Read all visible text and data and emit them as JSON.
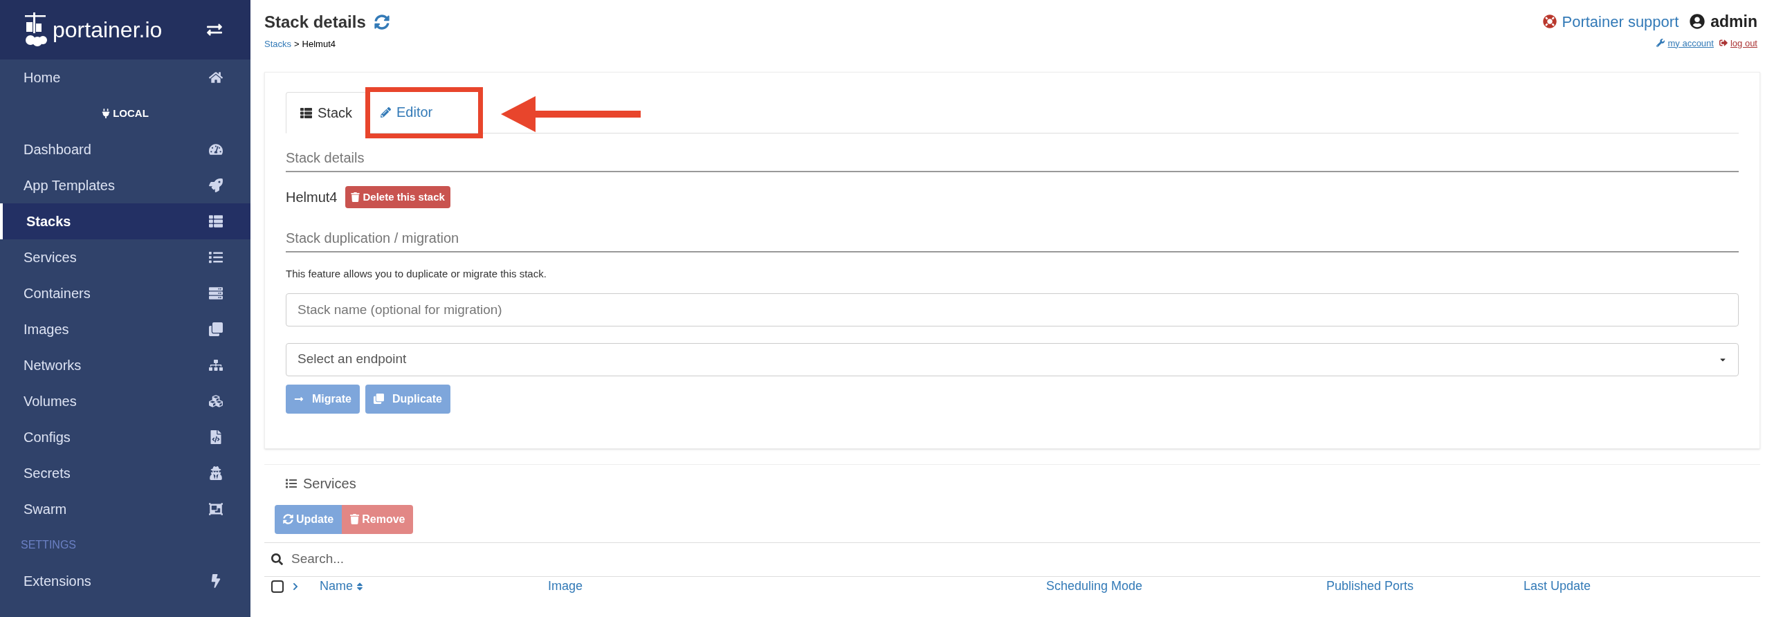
{
  "sidebar": {
    "logo": "portainer.io",
    "items": [
      {
        "kind": "item",
        "label": "Home",
        "selected": false
      },
      {
        "kind": "endpoint",
        "label": "LOCAL"
      },
      {
        "kind": "item",
        "label": "Dashboard",
        "selected": false
      },
      {
        "kind": "item",
        "label": "App Templates",
        "selected": false
      },
      {
        "kind": "item",
        "label": "Stacks",
        "selected": true
      },
      {
        "kind": "item",
        "label": "Services",
        "selected": false
      },
      {
        "kind": "item",
        "label": "Containers",
        "selected": false
      },
      {
        "kind": "item",
        "label": "Images",
        "selected": false
      },
      {
        "kind": "item",
        "label": "Networks",
        "selected": false
      },
      {
        "kind": "item",
        "label": "Volumes",
        "selected": false
      },
      {
        "kind": "item",
        "label": "Configs",
        "selected": false
      },
      {
        "kind": "item",
        "label": "Secrets",
        "selected": false
      },
      {
        "kind": "item",
        "label": "Swarm",
        "selected": false
      },
      {
        "kind": "section",
        "label": "SETTINGS"
      },
      {
        "kind": "item",
        "label": "Extensions",
        "selected": false
      }
    ]
  },
  "header": {
    "title": "Stack details",
    "breadcrumb": {
      "link": "Stacks",
      "separator": ">",
      "current": "Helmut4"
    },
    "support": "Portainer support",
    "user": "admin",
    "account_link": "my account",
    "logout_link": "log out"
  },
  "tabs": [
    {
      "label": "Stack",
      "selected": true,
      "annotated": false
    },
    {
      "label": "Editor",
      "selected": false,
      "annotated": true
    }
  ],
  "stack_details": {
    "heading": "Stack details",
    "name": "Helmut4",
    "delete_button": "Delete this stack"
  },
  "duplication": {
    "heading": "Stack duplication / migration",
    "description": "This feature allows you to duplicate or migrate this stack.",
    "name_field": {
      "placeholder": "Stack name (optional for migration)"
    },
    "endpoint_select": {
      "placeholder": "Select an endpoint"
    },
    "buttons": [
      "Migrate",
      "Duplicate"
    ]
  },
  "services": {
    "title": "Services",
    "buttons": [
      {
        "kind": "update",
        "label": "Update"
      },
      {
        "kind": "remove",
        "label": "Remove"
      }
    ],
    "search": {
      "placeholder": "Search..."
    },
    "select_all": {
      "checked": false
    },
    "columns": [
      {
        "label": "Name",
        "sorted": true
      },
      {
        "label": "Image",
        "sorted": false
      },
      {
        "label": "Scheduling Mode",
        "sorted": false
      },
      {
        "label": "Published Ports",
        "sorted": false
      },
      {
        "label": "Last Update",
        "sorted": false
      }
    ]
  }
}
